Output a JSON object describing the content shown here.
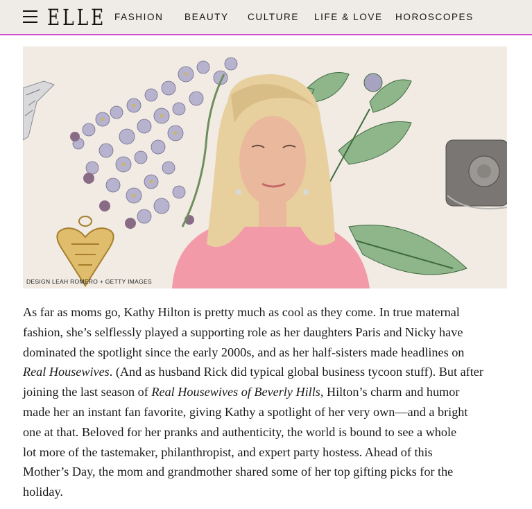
{
  "header": {
    "logo": "ELLE",
    "nav": [
      "FASHION",
      "BEAUTY",
      "CULTURE",
      "LIFE & LOVE",
      "HOROSCOPES"
    ],
    "accent_color": "#d44fd1",
    "background": "#efece7"
  },
  "hero": {
    "credit": "DESIGN LEAH ROMERO + GETTY IMAGES",
    "background": "#f1ebe4"
  },
  "article": {
    "lines": [
      [
        "As far as moms go, Kathy Hilton is pretty much as cool as they come. In true maternal"
      ],
      [
        "fashion, she’s selflessly played a supporting role as her daughters Paris and Nicky have"
      ],
      [
        "dominated the spotlight since the early 2000s, and as her half-sisters made headlines on"
      ],
      [
        "",
        "Real Housewives",
        ". (And as husband Rick did typical global business tycoon stuff). But after"
      ],
      [
        "joining the last season of ",
        "Real Housewives of Beverly Hills",
        ", Hilton’s charm and humor"
      ],
      [
        "made her an instant fan favorite, giving Kathy a spotlight of her very own—and a bright"
      ],
      [
        "one at that. Beloved for her pranks and authenticity, the world is bound to see a whole"
      ],
      [
        "lot more of the tastemaker, philanthropist, and expert party hostess. Ahead of this"
      ],
      [
        "Mother’s Day, the mom and grandmother shared some of her top gifting picks for the"
      ],
      [
        "holiday."
      ]
    ]
  }
}
